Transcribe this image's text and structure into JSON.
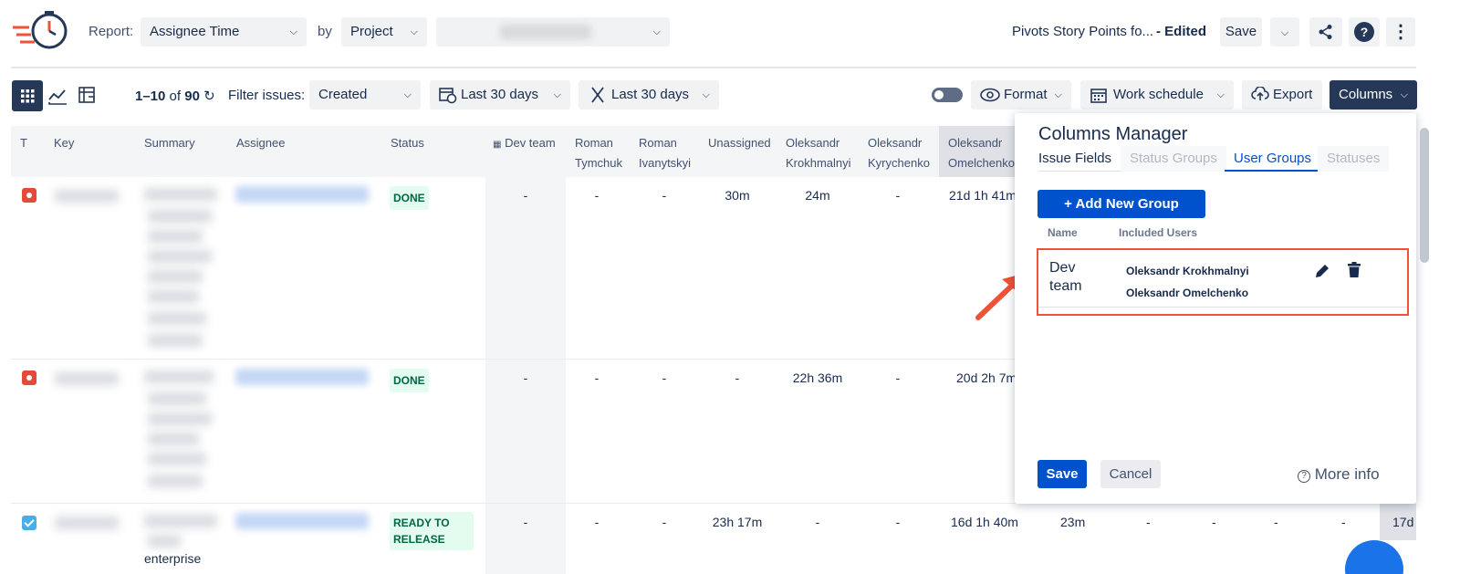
{
  "header": {
    "report_label": "Report:",
    "report_value": "Assignee Time",
    "by_label": "by",
    "by_value": "Project",
    "report_name": "Pivots Story Points fo...",
    "edited": "- Edited",
    "save": "Save",
    "help_icon": "?",
    "more_icon": "⋮"
  },
  "toolbar": {
    "count_range": "1–10",
    "count_of": "of",
    "count_total": "90",
    "filter_label": "Filter issues:",
    "filter_value": "Created",
    "date1": "Last 30 days",
    "date2": "Last 30 days",
    "format": "Format",
    "work_schedule": "Work schedule",
    "export": "Export",
    "columns": "Columns"
  },
  "table": {
    "headers": {
      "t": "T",
      "key": "Key",
      "summary": "Summary",
      "assignee": "Assignee",
      "status": "Status",
      "devteam": "Dev team",
      "roman_t1": "Roman",
      "roman_t2": "Tymchuk",
      "roman_i1": "Roman",
      "roman_i2": "Ivanytskyi",
      "unassigned": "Unassigned",
      "krokh1": "Oleksandr",
      "krokh2": "Krokhmalnyi",
      "kyry1": "Oleksandr",
      "kyry2": "Kyrychenko",
      "omel1": "Oleksandr",
      "omel2": "Omelchenko"
    },
    "rows": [
      {
        "status": "DONE",
        "dev": "-",
        "rt": "-",
        "ri": "-",
        "un": "30m",
        "kr": "24m",
        "ky": "-",
        "om": "21d 1h 41m"
      },
      {
        "status": "DONE",
        "dev": "-",
        "rt": "-",
        "ri": "-",
        "un": "-",
        "kr": "22h 36m",
        "ky": "-",
        "om": "20d 2h 7m"
      },
      {
        "status1": "READY TO",
        "status2": "RELEASE",
        "dev": "-",
        "rt": "-",
        "ri": "-",
        "un": "23h 17m",
        "kr": "-",
        "ky": "-",
        "om": "16d 1h 40m",
        "x1": "23m",
        "x2": "-",
        "x3": "-",
        "x4": "-",
        "x5": "-",
        "x6": "17d",
        "summary_tail": "enterprise"
      }
    ]
  },
  "columns_manager": {
    "title": "Columns Manager",
    "tabs": [
      "Issue Fields",
      "Status Groups",
      "User Groups",
      "Statuses"
    ],
    "add_group": "+ Add New Group",
    "col_name": "Name",
    "col_users": "Included Users",
    "group_name": "Dev team",
    "users": [
      "Oleksandr Krokhmalnyi",
      "Oleksandr Omelchenko"
    ],
    "save": "Save",
    "cancel": "Cancel",
    "more_info": "More info"
  },
  "colors": {
    "primary": "#0052cc",
    "dark": "#253858",
    "done_bg": "#e3fcef",
    "highlight": "#ef5234"
  }
}
